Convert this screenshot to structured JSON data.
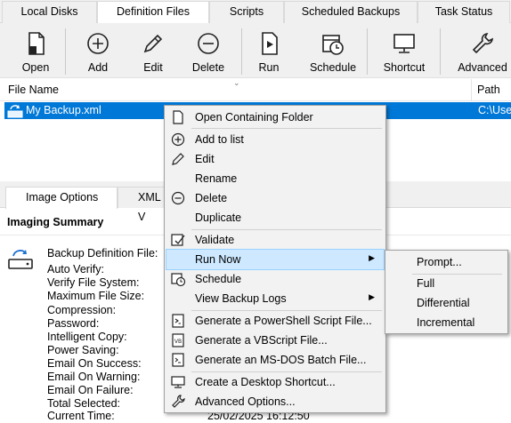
{
  "tabs": [
    "Local Disks",
    "Definition Files",
    "Scripts",
    "Scheduled Backups",
    "Task Status"
  ],
  "toolbar": {
    "open": "Open",
    "add": "Add",
    "edit": "Edit",
    "delete": "Delete",
    "run": "Run",
    "schedule": "Schedule",
    "shortcut": "Shortcut",
    "advanced": "Advanced"
  },
  "list": {
    "col_file_name": "File Name",
    "col_path": "Path",
    "rows": [
      {
        "name": "My Backup.xml",
        "path": "C:\\Users\\"
      }
    ]
  },
  "subtabs": [
    "Image Options",
    "XML V"
  ],
  "summary": {
    "title": "Imaging Summary",
    "labels": [
      "Backup Definition File:",
      "Auto Verify:",
      "Verify File System:",
      "Maximum File Size:",
      "Compression:",
      "Password:",
      "Intelligent Copy:",
      "Power Saving:",
      "Email On Success:",
      "Email On Warning:",
      "Email On Failure:",
      "Total Selected:",
      "Current Time:"
    ],
    "current_time_value": "25/02/2025 16:12:50"
  },
  "context_menu": {
    "items": [
      "Open Containing Folder",
      "Add to list",
      "Edit",
      "Rename",
      "Delete",
      "Duplicate",
      "Validate",
      "Run Now",
      "Schedule",
      "View Backup Logs",
      "Generate a PowerShell Script File...",
      "Generate a VBScript File...",
      "Generate an MS-DOS Batch File...",
      "Create a Desktop Shortcut...",
      "Advanced Options..."
    ],
    "highlighted": "Run Now"
  },
  "run_now_submenu": {
    "items": [
      "Prompt...",
      "Full",
      "Differential",
      "Incremental"
    ]
  },
  "colors": {
    "selection": "#0078d7",
    "menu_highlight": "#cde8ff",
    "toolbar_bg": "#f0f0f0"
  }
}
